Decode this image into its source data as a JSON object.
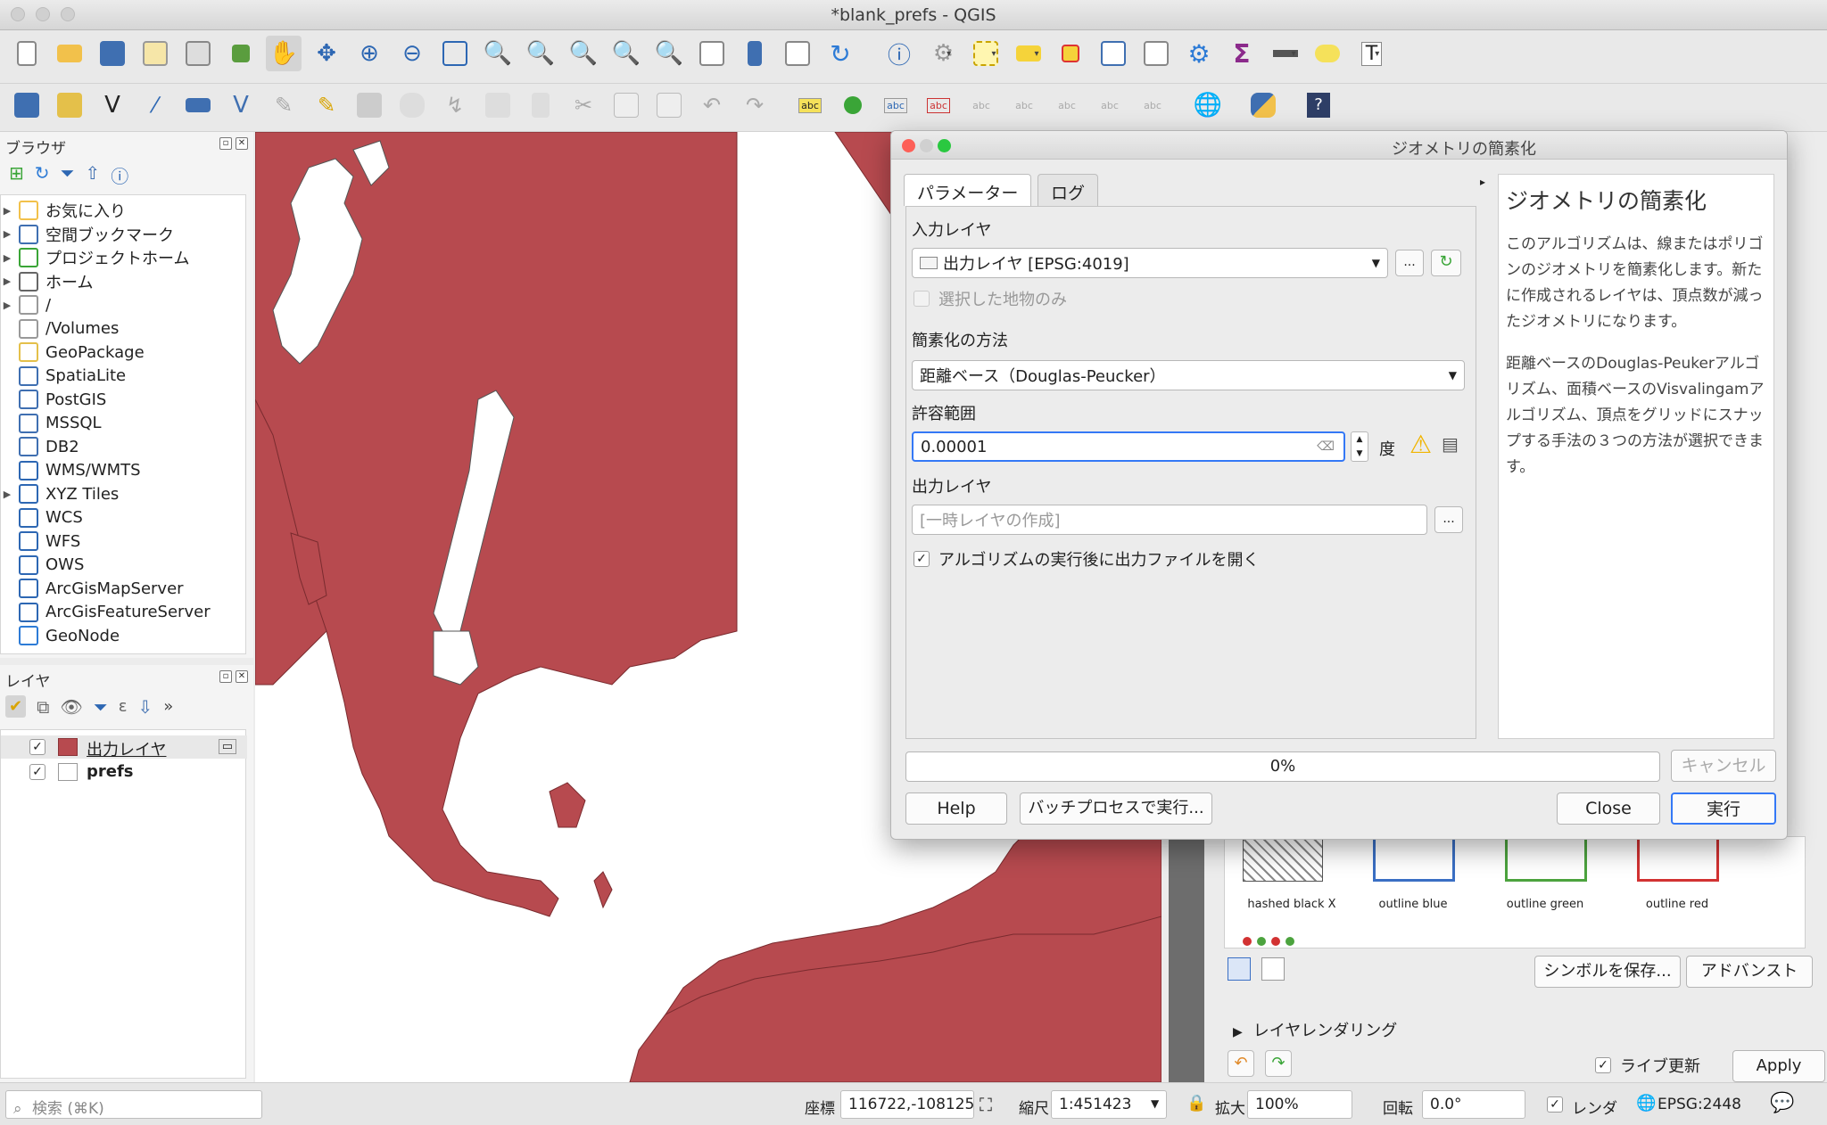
{
  "window": {
    "title": "*blank_prefs - QGIS"
  },
  "browser_panel": {
    "title": "ブラウザ",
    "items": [
      {
        "label": "お気に入り",
        "icon": "star-icon",
        "expand": true
      },
      {
        "label": "空間ブックマーク",
        "icon": "bookmark-icon",
        "expand": true
      },
      {
        "label": "プロジェクトホーム",
        "icon": "project-home-icon",
        "expand": true
      },
      {
        "label": "ホーム",
        "icon": "home-icon",
        "expand": true
      },
      {
        "label": "/",
        "icon": "folder-icon",
        "expand": true
      },
      {
        "label": "/Volumes",
        "icon": "folder-icon",
        "expand": false
      },
      {
        "label": "GeoPackage",
        "icon": "geopackage-icon",
        "expand": false
      },
      {
        "label": "SpatiaLite",
        "icon": "spatialite-icon",
        "expand": false
      },
      {
        "label": "PostGIS",
        "icon": "postgis-icon",
        "expand": false
      },
      {
        "label": "MSSQL",
        "icon": "mssql-icon",
        "expand": false
      },
      {
        "label": "DB2",
        "icon": "db2-icon",
        "expand": false
      },
      {
        "label": "WMS/WMTS",
        "icon": "globe-icon",
        "expand": false
      },
      {
        "label": "XYZ Tiles",
        "icon": "globe-icon",
        "expand": true
      },
      {
        "label": "WCS",
        "icon": "globe-icon",
        "expand": false
      },
      {
        "label": "WFS",
        "icon": "globe-icon",
        "expand": false
      },
      {
        "label": "OWS",
        "icon": "globe-icon",
        "expand": false
      },
      {
        "label": "ArcGisMapServer",
        "icon": "globe-icon",
        "expand": false
      },
      {
        "label": "ArcGisFeatureServer",
        "icon": "globe-icon",
        "expand": false
      },
      {
        "label": "GeoNode",
        "icon": "geonode-icon",
        "expand": false
      }
    ]
  },
  "layers_panel": {
    "title": "レイヤ",
    "layers": [
      {
        "label": "出力レイヤ",
        "checked": true,
        "swatch": "#b74a4f"
      },
      {
        "label": "prefs",
        "checked": true,
        "swatch": "#ffffff"
      }
    ]
  },
  "dialog": {
    "title": "ジオメトリの簡素化",
    "tabs": [
      "パラメーター",
      "ログ"
    ],
    "input_layer_label": "入力レイヤ",
    "input_layer_value": "出力レイヤ [EPSG:4019]",
    "selected_only_label": "選択した地物のみ",
    "method_label": "簡素化の方法",
    "method_value": "距離ベース（Douglas-Peucker）",
    "tolerance_label": "許容範囲",
    "tolerance_value": "0.00001",
    "tolerance_unit": "度",
    "output_label": "出力レイヤ",
    "output_placeholder": "[一時レイヤの作成]",
    "open_after_label": "アルゴリズムの実行後に出力ファイルを開く",
    "browse_label": "...",
    "progress": "0%",
    "progress_fraction": 0,
    "cancel_label": "キャンセル",
    "help_label": "Help",
    "batch_label": "バッチプロセスで実行...",
    "close_label": "Close",
    "run_label": "実行",
    "help_title": "ジオメトリの簡素化",
    "help_p1": "このアルゴリズムは、線またはポリゴンのジオメトリを簡素化します。新たに作成されるレイヤは、頂点数が減ったジオメトリになります。",
    "help_p2": "距離ベースのDouglas-Peukerアルゴリズム、面積ベースのVisvalingamアルゴリズム、頂点をグリッドにスナップする手法の３つの方法が選択できます。"
  },
  "style_panel": {
    "symbols": [
      "hashed black X",
      "outline blue",
      "outline green",
      "outline red"
    ],
    "save_symbol_label": "シンボルを保存...",
    "advanced_label": "アドバンスト",
    "layer_rendering_label": "レイヤレンダリング",
    "live_update_label": "ライブ更新",
    "apply_label": "Apply"
  },
  "statusbar": {
    "search_placeholder": "検索 (⌘K)",
    "coord_label": "座標",
    "coord_value": "116722,-108125",
    "scale_label": "縮尺",
    "scale_value": "1:451423",
    "magnifier_label": "拡大",
    "magnifier_value": "100%",
    "rotation_label": "回転",
    "rotation_value": "0.0°",
    "render_label": "レンダ",
    "crs_label": "EPSG:2448"
  },
  "colors": {
    "map_fill": "#b74a4f",
    "accent": "#3478f6"
  }
}
